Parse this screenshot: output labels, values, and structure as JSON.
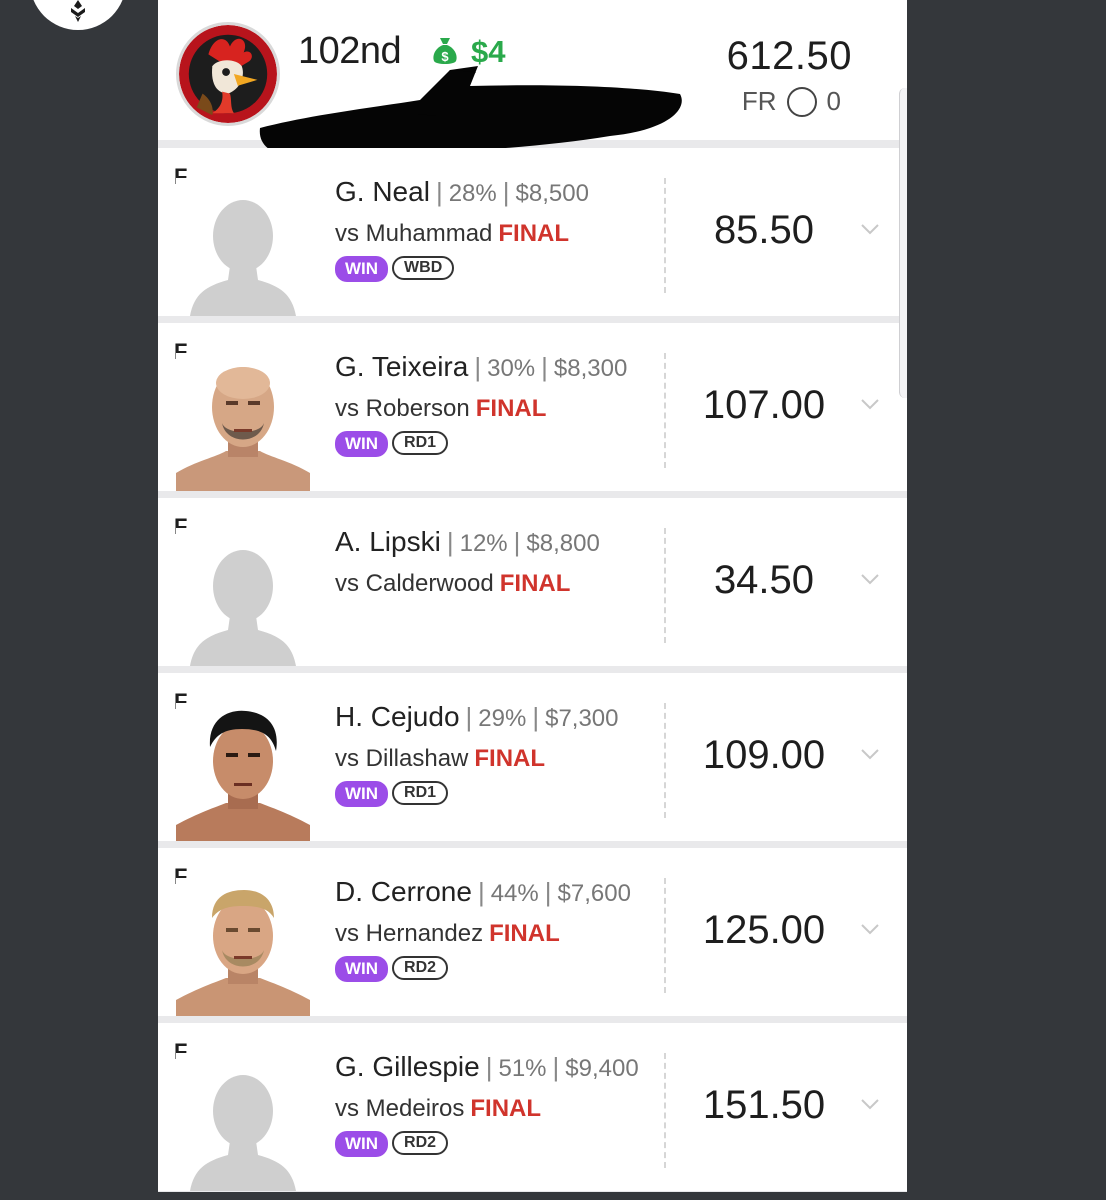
{
  "header": {
    "rank": "102nd",
    "winnings": "$4",
    "total_points": "612.50",
    "fr_label": "FR",
    "fr_value": "0"
  },
  "players": [
    {
      "pos": "F",
      "name": "G. Neal",
      "own": "28%",
      "salary": "$8,500",
      "opponent": "vs Muhammad",
      "status": "FINAL",
      "result": "WIN",
      "method": "WBD",
      "points": "85.50",
      "photo": "placeholder"
    },
    {
      "pos": "F",
      "name": "G. Teixeira",
      "own": "30%",
      "salary": "$8,300",
      "opponent": "vs Roberson",
      "status": "FINAL",
      "result": "WIN",
      "method": "RD1",
      "points": "107.00",
      "photo": "bald"
    },
    {
      "pos": "F",
      "name": "A. Lipski",
      "own": "12%",
      "salary": "$8,800",
      "opponent": "vs Calderwood",
      "status": "FINAL",
      "result": "",
      "method": "",
      "points": "34.50",
      "photo": "placeholder"
    },
    {
      "pos": "F",
      "name": "H. Cejudo",
      "own": "29%",
      "salary": "$7,300",
      "opponent": "vs Dillashaw",
      "status": "FINAL",
      "result": "WIN",
      "method": "RD1",
      "points": "109.00",
      "photo": "dark-hair"
    },
    {
      "pos": "F",
      "name": "D. Cerrone",
      "own": "44%",
      "salary": "$7,600",
      "opponent": "vs Hernandez",
      "status": "FINAL",
      "result": "WIN",
      "method": "RD2",
      "points": "125.00",
      "photo": "blond"
    },
    {
      "pos": "F",
      "name": "G. Gillespie",
      "own": "51%",
      "salary": "$9,400",
      "opponent": "vs Medeiros",
      "status": "FINAL",
      "result": "WIN",
      "method": "RD2",
      "points": "151.50",
      "photo": "placeholder"
    }
  ],
  "colors": {
    "win_badge": "#9b4de8",
    "final_text": "#d0342c",
    "winnings_text": "#2aa94b"
  },
  "icons": {
    "avatar": "rooster-logo",
    "money": "money-bag-icon",
    "expand": "chevron-down-icon",
    "corner": "brand-logo"
  }
}
